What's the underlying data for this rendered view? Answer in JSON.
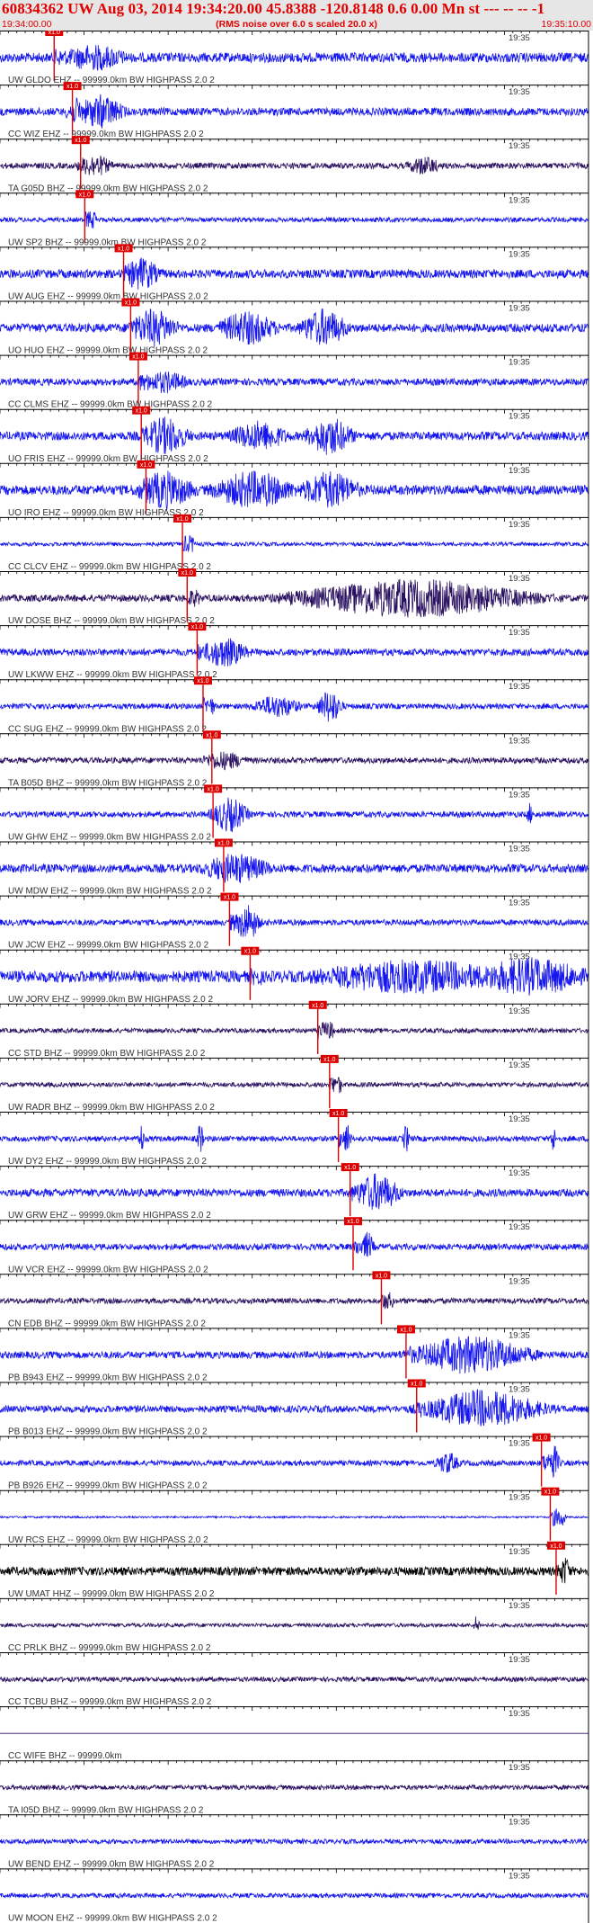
{
  "header": {
    "title": "60834362 UW Aug 03, 2014 19:34:20.00   45.8388 -120.8148  0.6 0.00 Mn st --- -- --   -1",
    "start_time": "19:34:00.00",
    "note": "(RMS noise over 6.0 s scaled 20.0 x)",
    "end_time": "19:35:10.00"
  },
  "time_marker": "19:35",
  "pick_tag": "x1.0",
  "colors": {
    "trace_blue": "#1515ee",
    "trace_navy": "#2a1060",
    "trace_black": "#000000",
    "pick_red": "#dd0000",
    "label_gray": "#333333"
  },
  "traces": [
    {
      "label": "UW GLDO EHZ -- 99999.0km BW  HIGHPASS  2.0  2",
      "color": "#1515ee",
      "pick": 0.092,
      "amp": 0.25,
      "bursts": [
        [
          0.16,
          0.06,
          0.7
        ]
      ]
    },
    {
      "label": "CC WIZ EHZ -- 99999.0km BW  HIGHPASS  2.0  2",
      "color": "#1515ee",
      "pick": 0.123,
      "amp": 0.2,
      "bursts": [
        [
          0.17,
          0.04,
          0.9
        ],
        [
          0.13,
          0.02,
          0.7
        ]
      ]
    },
    {
      "label": "TA G05D BHZ -- 99999.0km BW  HIGHPASS  2.0  2",
      "color": "#2a1060",
      "pick": 0.137,
      "amp": 0.15,
      "bursts": [
        [
          0.16,
          0.03,
          0.6
        ],
        [
          0.72,
          0.03,
          0.5
        ]
      ]
    },
    {
      "label": "UW SP2 BHZ -- 99999.0km BW  HIGHPASS  2.0  2",
      "color": "#1515ee",
      "pick": 0.144,
      "amp": 0.12,
      "bursts": []
    },
    {
      "label": "UW AUG EHZ -- 99999.0km BW  HIGHPASS  2.0  2",
      "color": "#1515ee",
      "pick": 0.21,
      "amp": 0.22,
      "bursts": [
        [
          0.24,
          0.03,
          0.9
        ]
      ]
    },
    {
      "label": "UO HUO EHZ -- 99999.0km BW  HIGHPASS  2.0  2",
      "color": "#1515ee",
      "pick": 0.222,
      "amp": 0.22,
      "bursts": [
        [
          0.26,
          0.04,
          1.0
        ],
        [
          0.42,
          0.05,
          0.9
        ],
        [
          0.55,
          0.04,
          1.0
        ]
      ]
    },
    {
      "label": "CC CLMS EHZ -- 99999.0km BW  HIGHPASS  2.0  2",
      "color": "#1515ee",
      "pick": 0.235,
      "amp": 0.18,
      "bursts": [
        [
          0.28,
          0.04,
          0.6
        ]
      ]
    },
    {
      "label": "UO FRIS EHZ -- 99999.0km BW  HIGHPASS  2.0  2",
      "color": "#1515ee",
      "pick": 0.24,
      "amp": 0.22,
      "bursts": [
        [
          0.28,
          0.04,
          1.0
        ],
        [
          0.44,
          0.05,
          0.8
        ],
        [
          0.56,
          0.04,
          1.0
        ]
      ]
    },
    {
      "label": "UO IRO EHZ -- 99999.0km BW  HIGHPASS  2.0  2",
      "color": "#1515ee",
      "pick": 0.248,
      "amp": 0.25,
      "bursts": [
        [
          0.28,
          0.05,
          1.0
        ],
        [
          0.43,
          0.07,
          1.0
        ],
        [
          0.56,
          0.05,
          1.0
        ]
      ]
    },
    {
      "label": "CC CLCV EHZ -- 99999.0km BW  HIGHPASS  2.0  2",
      "color": "#1515ee",
      "pick": 0.31,
      "amp": 0.1,
      "bursts": [
        [
          0.32,
          0.01,
          0.4
        ]
      ]
    },
    {
      "label": "UW DOSE BHZ -- 99999.0km BW  HIGHPASS  2.0  2",
      "color": "#2a1060",
      "pick": 0.318,
      "amp": 0.18,
      "bursts": [
        [
          0.7,
          0.2,
          1.0
        ]
      ]
    },
    {
      "label": "UW LKWW EHZ -- 99999.0km BW  HIGHPASS  2.0  2",
      "color": "#1515ee",
      "pick": 0.335,
      "amp": 0.18,
      "bursts": [
        [
          0.38,
          0.04,
          0.8
        ]
      ]
    },
    {
      "label": "CC SUG EHZ -- 99999.0km BW  HIGHPASS  2.0  2",
      "color": "#1515ee",
      "pick": 0.345,
      "amp": 0.14,
      "bursts": [
        [
          0.47,
          0.04,
          0.6
        ],
        [
          0.56,
          0.02,
          0.9
        ]
      ]
    },
    {
      "label": "TA B05D BHZ -- 99999.0km BW  HIGHPASS  2.0  2",
      "color": "#2a1060",
      "pick": 0.36,
      "amp": 0.15,
      "bursts": [
        [
          0.38,
          0.04,
          0.5
        ]
      ]
    },
    {
      "label": "UW GHW EHZ -- 99999.0km BW  HIGHPASS  2.0  2",
      "color": "#1515ee",
      "pick": 0.362,
      "amp": 0.15,
      "bursts": [
        [
          0.39,
          0.03,
          0.9
        ],
        [
          0.9,
          0.005,
          0.6
        ]
      ]
    },
    {
      "label": "UW MDW EHZ -- 99999.0km BW  HIGHPASS  2.0  2",
      "color": "#1515ee",
      "pick": 0.38,
      "amp": 0.22,
      "bursts": [
        [
          0.4,
          0.06,
          0.8
        ]
      ]
    },
    {
      "label": "UW JCW EHZ -- 99999.0km BW  HIGHPASS  2.0  2",
      "color": "#1515ee",
      "pick": 0.39,
      "amp": 0.15,
      "bursts": [
        [
          0.42,
          0.02,
          1.0
        ]
      ]
    },
    {
      "label": "UW JORV EHZ -- 99999.0km BW  HIGHPASS  2.0  2",
      "color": "#1515ee",
      "pick": 0.425,
      "amp": 0.3,
      "bursts": [
        [
          0.7,
          0.18,
          0.9
        ],
        [
          0.9,
          0.1,
          1.0
        ]
      ]
    },
    {
      "label": "CC STD BHZ -- 99999.0km BW  HIGHPASS  2.0  2",
      "color": "#2a1060",
      "pick": 0.54,
      "amp": 0.12,
      "bursts": [
        [
          0.56,
          0.01,
          0.5
        ]
      ]
    },
    {
      "label": "UW RADR BHZ -- 99999.0km BW  HIGHPASS  2.0  2",
      "color": "#2a1060",
      "pick": 0.56,
      "amp": 0.12,
      "bursts": []
    },
    {
      "label": "UW DY2 EHZ -- 99999.0km BW  HIGHPASS  2.0  2",
      "color": "#1515ee",
      "pick": 0.575,
      "amp": 0.14,
      "bursts": [
        [
          0.24,
          0.005,
          0.8
        ],
        [
          0.34,
          0.005,
          0.9
        ],
        [
          0.59,
          0.006,
          0.9
        ],
        [
          0.69,
          0.005,
          0.8
        ],
        [
          0.94,
          0.005,
          0.7
        ]
      ]
    },
    {
      "label": "UW GRW EHZ -- 99999.0km BW  HIGHPASS  2.0  2",
      "color": "#1515ee",
      "pick": 0.595,
      "amp": 0.2,
      "bursts": [
        [
          0.64,
          0.04,
          1.0
        ]
      ]
    },
    {
      "label": "UW VCR EHZ -- 99999.0km BW  HIGHPASS  2.0  2",
      "color": "#1515ee",
      "pick": 0.6,
      "amp": 0.16,
      "bursts": [
        [
          0.625,
          0.01,
          0.8
        ]
      ]
    },
    {
      "label": "CN EDB BHZ -- 99999.0km BW  HIGHPASS  2.0  2",
      "color": "#2a1060",
      "pick": 0.648,
      "amp": 0.14,
      "bursts": []
    },
    {
      "label": "PB B943 EHZ -- 99999.0km BW  HIGHPASS  2.0  2",
      "color": "#1515ee",
      "pick": 0.69,
      "amp": 0.18,
      "bursts": [
        [
          0.8,
          0.1,
          1.0
        ]
      ]
    },
    {
      "label": "PB B013 EHZ -- 99999.0km BW  HIGHPASS  2.0  2",
      "color": "#1515ee",
      "pick": 0.708,
      "amp": 0.18,
      "bursts": [
        [
          0.82,
          0.1,
          1.0
        ]
      ]
    },
    {
      "label": "PB B926 EHZ -- 99999.0km BW  HIGHPASS  2.0  2",
      "color": "#1515ee",
      "pick": 0.92,
      "amp": 0.14,
      "bursts": [
        [
          0.76,
          0.02,
          0.6
        ],
        [
          0.94,
          0.01,
          1.0
        ]
      ]
    },
    {
      "label": "UW RCS EHZ -- 99999.0km BW  HIGHPASS  2.0  2",
      "color": "#1515ee",
      "pick": 0.935,
      "amp": 0.05,
      "bursts": [
        [
          0.955,
          0.005,
          0.6
        ]
      ]
    },
    {
      "label": "UW UMAT HHZ -- 99999.0km BW  HIGHPASS  2.0  2",
      "color": "#000000",
      "pick": 0.945,
      "amp": 0.22,
      "bursts": [
        [
          0.96,
          0.01,
          0.8
        ]
      ]
    },
    {
      "label": "CC PRLK BHZ -- 99999.0km BW  HIGHPASS  2.0  2",
      "color": "#2a1060",
      "pick": null,
      "amp": 0.1,
      "bursts": [
        [
          0.81,
          0.005,
          0.5
        ]
      ]
    },
    {
      "label": "CC TCBU BHZ -- 99999.0km BW  HIGHPASS  2.0  2",
      "color": "#2a1060",
      "pick": null,
      "amp": 0.12,
      "bursts": []
    },
    {
      "label": "CC WIFE BHZ -- 99999.0km",
      "color": "#2a1060",
      "pick": null,
      "amp": 0.0,
      "bursts": []
    },
    {
      "label": "TA I05D BHZ -- 99999.0km BW  HIGHPASS  2.0  2",
      "color": "#2a1060",
      "pick": null,
      "amp": 0.12,
      "bursts": []
    },
    {
      "label": "UW BEND EHZ -- 99999.0km BW  HIGHPASS  2.0  2",
      "color": "#1515ee",
      "pick": null,
      "amp": 0.12,
      "bursts": []
    },
    {
      "label": "UW MOON EHZ -- 99999.0km BW  HIGHPASS  2.0  2",
      "color": "#1515ee",
      "pick": null,
      "amp": 0.12,
      "bursts": []
    }
  ]
}
